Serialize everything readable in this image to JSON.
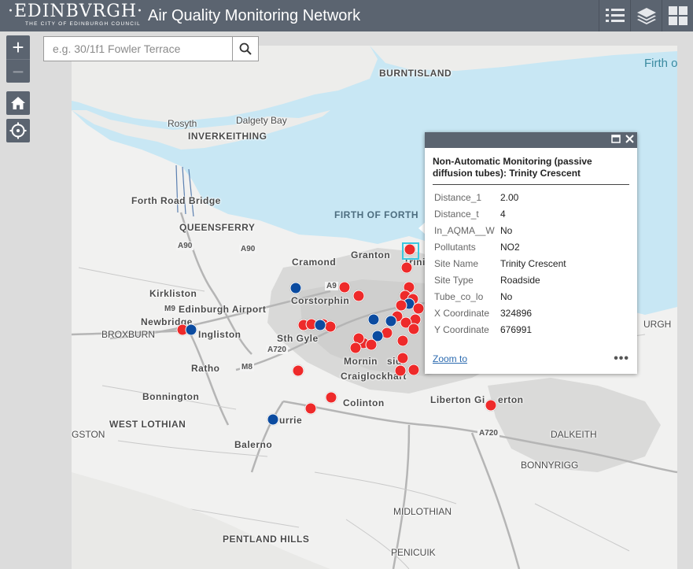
{
  "header": {
    "logo_text": "·EDINBVRGH·",
    "logo_subtext": "THE CITY OF EDINBURGH COUNCIL",
    "title": "Air Quality Monitoring Network"
  },
  "search": {
    "placeholder": "e.g. 30/1f1 Fowler Terrace"
  },
  "zoom": {
    "in_label": "+",
    "out_label": "−"
  },
  "map_labels": {
    "burntisland": "BURNTISLAND",
    "firth_right": "Firth o",
    "rosyth": "Rosyth",
    "dalgety_bay": "Dalgety Bay",
    "inverkeithing": "INVERKEITHING",
    "forth_road_bridge": "Forth Road Bridge",
    "firth_of_forth": "FIRTH OF FORTH",
    "queensferry": "QUEENSFERRY",
    "a90_left": "A90",
    "a90_right": "A90",
    "cramond": "Cramond",
    "granton": "Granton",
    "trinity": "Trinit",
    "kirkliston": "Kirkliston",
    "a9": "A9",
    "corstorphine": "Corstorphin",
    "m9": "M9",
    "edinburgh_airport": "Edinburgh Airport",
    "newbridge": "Newbridge",
    "broxburn": "BROXBURN",
    "ingliston": "Ingliston",
    "sth_gyle": "Sth Gyle",
    "a720_left": "A720",
    "ratho": "Ratho",
    "m8": "M8",
    "morningside": "Mornin",
    "morningside_2": "sid",
    "craiglockhart": "Craiglockhart",
    "bonnington": "Bonnington",
    "colinton": "Colinton",
    "liberton": "Liberton",
    "gilmerton": "Gi",
    "gilmerton_2": "erton",
    "livingston": "GSTON",
    "west_lothian": "WEST LOTHIAN",
    "currie": "urrie",
    "balerno": "Balerno",
    "a720_right": "A720",
    "dalkeith": "DALKEITH",
    "bonnyrigg": "BONNYRIGG",
    "midlothian": "MIDLOTHIAN",
    "pentland_hills": "PENTLAND HILLS",
    "penicuik": "PENICUIK",
    "burgh": "URGH"
  },
  "popup": {
    "title": "Non-Automatic Monitoring (passive diffusion tubes): Trinity Crescent",
    "fields": [
      {
        "key": "Distance_1",
        "value": "2.00"
      },
      {
        "key": "Distance_t",
        "value": "4"
      },
      {
        "key": "In_AQMA__W",
        "value": "No"
      },
      {
        "key": "Pollutants",
        "value": "NO2"
      },
      {
        "key": "Site Name",
        "value": "Trinity Crescent"
      },
      {
        "key": "Site Type",
        "value": "Roadside"
      },
      {
        "key": "Tube_co_lo",
        "value": "No"
      },
      {
        "key": "X Coordinate",
        "value": "324896"
      },
      {
        "key": "Y Coordinate",
        "value": "676991"
      }
    ],
    "zoom_to": "Zoom to",
    "more": "•••"
  },
  "colors": {
    "header": "#5b6470",
    "sea": "#c8e7f4",
    "marker_red": "#ee2a2a",
    "marker_blue": "#0b4ba0",
    "selection": "#3cc7e0",
    "link": "#2c6bb0"
  },
  "icons": [
    "list-icon",
    "layers-icon",
    "grid-icon",
    "search-icon",
    "home-icon",
    "locate-icon",
    "maximize-icon",
    "close-icon"
  ]
}
